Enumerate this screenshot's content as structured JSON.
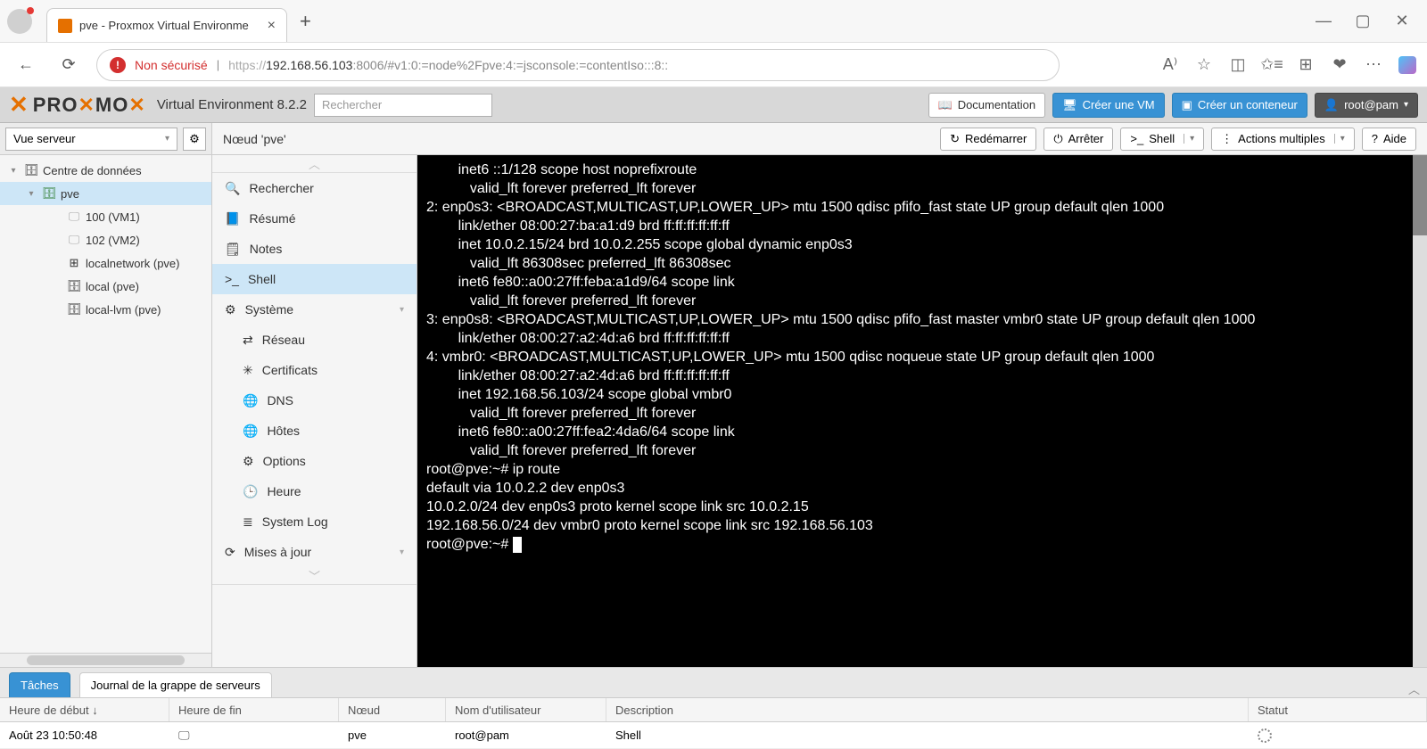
{
  "browser": {
    "tab_title": "pve - Proxmox Virtual Environme",
    "not_secure": "Non sécurisé",
    "url_scheme": "https://",
    "url_host": "192.168.56.103",
    "url_path": ":8006/#v1:0:=node%2Fpve:4:=jsconsole:=contentIso:::8::"
  },
  "header": {
    "product": "Virtual Environment 8.2.2",
    "search_placeholder": "Rechercher",
    "doc": "Documentation",
    "create_vm": "Créer une VM",
    "create_ct": "Créer un conteneur",
    "user": "root@pam"
  },
  "view_selector": "Vue serveur",
  "tree": {
    "datacenter": "Centre de données",
    "node": "pve",
    "vm1": "100 (VM1)",
    "vm2": "102 (VM2)",
    "net": "localnetwork (pve)",
    "local": "local (pve)",
    "localvm": "local-lvm (pve)"
  },
  "content": {
    "title": "Nœud 'pve'",
    "restart": "Redémarrer",
    "stop": "Arrêter",
    "shell": "Shell",
    "bulk": "Actions multiples",
    "help": "Aide"
  },
  "menu": {
    "search": "Rechercher",
    "summary": "Résumé",
    "notes": "Notes",
    "shell": "Shell",
    "system": "Système",
    "network": "Réseau",
    "certs": "Certificats",
    "dns": "DNS",
    "hosts": "Hôtes",
    "options": "Options",
    "time": "Heure",
    "syslog": "System Log",
    "updates": "Mises à jour"
  },
  "terminal_lines": [
    "        inet6 ::1/128 scope host noprefixroute",
    "           valid_lft forever preferred_lft forever",
    "2: enp0s3: <BROADCAST,MULTICAST,UP,LOWER_UP> mtu 1500 qdisc pfifo_fast state UP group default qlen 1000",
    "        link/ether 08:00:27:ba:a1:d9 brd ff:ff:ff:ff:ff:ff",
    "        inet 10.0.2.15/24 brd 10.0.2.255 scope global dynamic enp0s3",
    "           valid_lft 86308sec preferred_lft 86308sec",
    "        inet6 fe80::a00:27ff:feba:a1d9/64 scope link",
    "           valid_lft forever preferred_lft forever",
    "3: enp0s8: <BROADCAST,MULTICAST,UP,LOWER_UP> mtu 1500 qdisc pfifo_fast master vmbr0 state UP group default qlen 1000",
    "        link/ether 08:00:27:a2:4d:a6 brd ff:ff:ff:ff:ff:ff",
    "4: vmbr0: <BROADCAST,MULTICAST,UP,LOWER_UP> mtu 1500 qdisc noqueue state UP group default qlen 1000",
    "        link/ether 08:00:27:a2:4d:a6 brd ff:ff:ff:ff:ff:ff",
    "        inet 192.168.56.103/24 scope global vmbr0",
    "           valid_lft forever preferred_lft forever",
    "        inet6 fe80::a00:27ff:fea2:4da6/64 scope link",
    "           valid_lft forever preferred_lft forever",
    "root@pve:~# ip route",
    "default via 10.0.2.2 dev enp0s3",
    "10.0.2.0/24 dev enp0s3 proto kernel scope link src 10.0.2.15",
    "192.168.56.0/24 dev vmbr0 proto kernel scope link src 192.168.56.103"
  ],
  "terminal_prompt": "root@pve:~# ",
  "tasks": {
    "tab_tasks": "Tâches",
    "tab_cluster": "Journal de la grappe de serveurs",
    "col_start": "Heure de début ↓",
    "col_end": "Heure de fin",
    "col_node": "Nœud",
    "col_user": "Nom d'utilisateur",
    "col_desc": "Description",
    "col_status": "Statut",
    "row": {
      "start": "Août 23 10:50:48",
      "node": "pve",
      "user": "root@pam",
      "desc": "Shell"
    }
  }
}
